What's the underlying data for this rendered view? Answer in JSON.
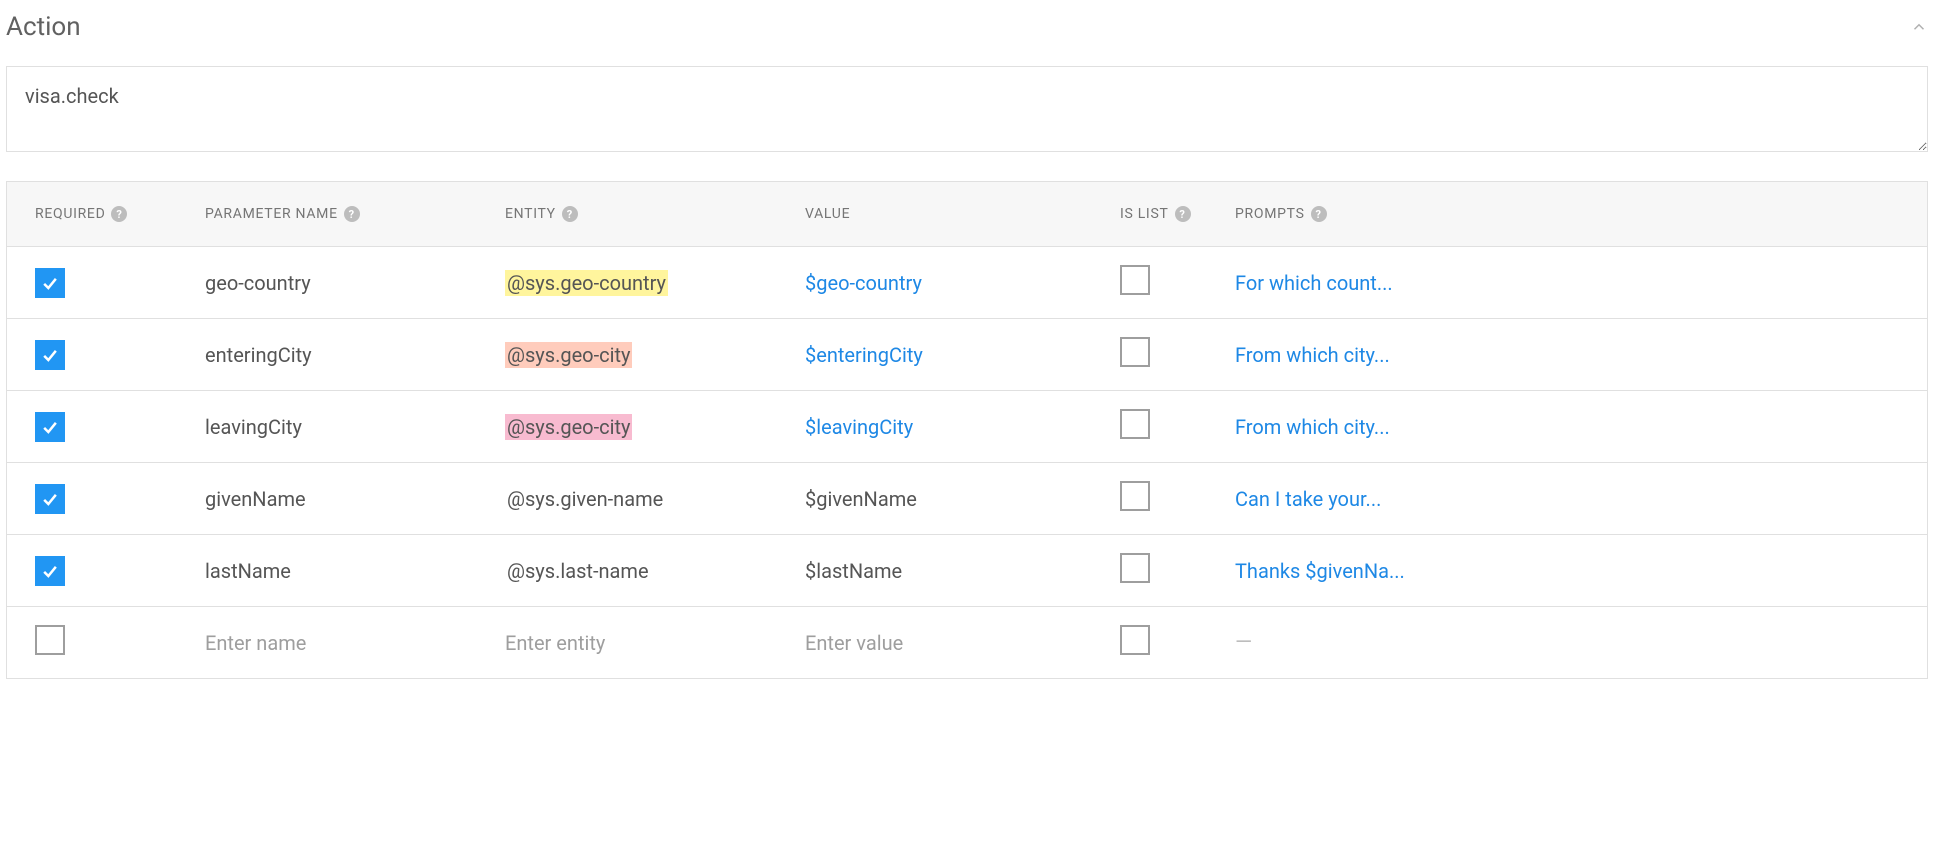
{
  "section": {
    "title": "Action"
  },
  "action": {
    "value": "visa.check"
  },
  "columns": {
    "required": "REQUIRED",
    "param": "PARAMETER NAME",
    "entity": "ENTITY",
    "value": "VALUE",
    "islist": "IS LIST",
    "prompts": "PROMPTS"
  },
  "rows": [
    {
      "required": true,
      "param": "geo-country",
      "entity": "@sys.geo-country",
      "entity_hl": "hl-yellow",
      "value": "$geo-country",
      "value_link": true,
      "islist": false,
      "prompt": "For which count..."
    },
    {
      "required": true,
      "param": "enteringCity",
      "entity": "@sys.geo-city",
      "entity_hl": "hl-orange",
      "value": "$enteringCity",
      "value_link": true,
      "islist": false,
      "prompt": "From which city..."
    },
    {
      "required": true,
      "param": "leavingCity",
      "entity": "@sys.geo-city",
      "entity_hl": "hl-pink",
      "value": "$leavingCity",
      "value_link": true,
      "islist": false,
      "prompt": "From which city..."
    },
    {
      "required": true,
      "param": "givenName",
      "entity": "@sys.given-name",
      "entity_hl": "",
      "value": "$givenName",
      "value_link": false,
      "islist": false,
      "prompt": "Can I take your..."
    },
    {
      "required": true,
      "param": "lastName",
      "entity": "@sys.last-name",
      "entity_hl": "",
      "value": "$lastName",
      "value_link": false,
      "islist": false,
      "prompt": "Thanks $givenNa..."
    }
  ],
  "new_row": {
    "param_placeholder": "Enter name",
    "entity_placeholder": "Enter entity",
    "value_placeholder": "Enter value",
    "prompt_placeholder": "—"
  }
}
